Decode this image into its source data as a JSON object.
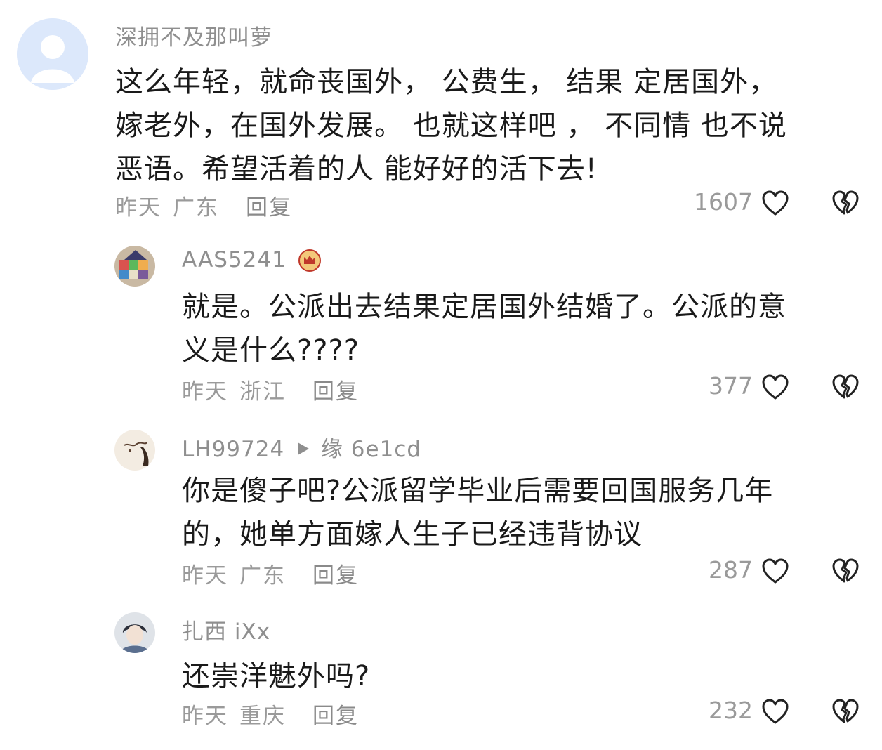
{
  "comments": [
    {
      "username": "深拥不及那叫萝",
      "text": "这么年轻，就命丧国外，   公费生，  结果 定居国外，嫁老外，在国外发展。 也就这样吧 ，   不同情 也不说恶语。希望活着的人 能好好的活下去!",
      "lines": [
        "这么年轻，就命丧国外，   公费生，  结果 定居国外，",
        "嫁老外，在国外发展。 也就这样吧 ，   不同情 也不说",
        "恶语。希望活着的人 能好好的活下去!"
      ],
      "time": "昨天",
      "region": "广东",
      "reply": "回复",
      "likes": "1607"
    },
    {
      "username": "AAS5241",
      "lines": [
        "就是。公派出去结果定居国外结婚了。公派的意",
        "义是什么????"
      ],
      "time": "昨天",
      "region": "浙江",
      "reply": "回复",
      "likes": "377"
    },
    {
      "username": "LH99724",
      "reply_to": "缘 6e1cd",
      "lines": [
        "你是傻子吧?公派留学毕业后需要回国服务几年",
        "的，她单方面嫁人生子已经违背协议"
      ],
      "time": "昨天",
      "region": "广东",
      "reply": "回复",
      "likes": "287"
    },
    {
      "username": "扎西 iXx",
      "lines": [
        "还崇洋魅外吗?"
      ],
      "time": "昨天",
      "region": "重庆",
      "reply": "回复",
      "likes": "232"
    }
  ],
  "icons": {
    "like": "heart-outline-icon",
    "dislike": "broken-heart-icon",
    "reply_arrow": "play-triangle-icon",
    "badge": "crown-badge-icon"
  },
  "colors": {
    "text": "#1a1a1a",
    "secondary": "#9a9a9a",
    "icon": "#222222"
  }
}
